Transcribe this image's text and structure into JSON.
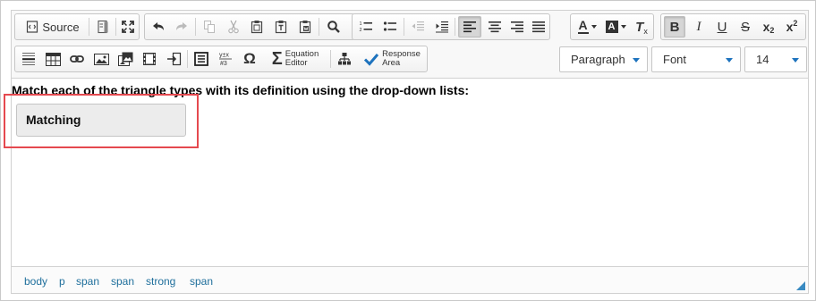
{
  "toolbar": {
    "row1": {
      "source_label": "Source",
      "format_text_color": "A",
      "format_bg_color": "A",
      "remove_format": "T",
      "bold": "B",
      "italic": "I",
      "underline": "U",
      "strike": "S",
      "subscript": "x",
      "subscript_mark": "2",
      "superscript": "x",
      "superscript_mark": "2"
    },
    "row2": {
      "equation_editor_line1": "Equation",
      "equation_editor_line2": "Editor",
      "response_area_line1": "Response",
      "response_area_line2": "Area",
      "omega": "Ω",
      "sigma": "Σ"
    },
    "dropdowns": {
      "paragraph": "Paragraph",
      "font": "Font",
      "size": "14"
    }
  },
  "content": {
    "prompt": "Match each of the triangle types with its definition using the drop-down lists:",
    "response_area_label": "Matching"
  },
  "status": {
    "path": [
      "body",
      "p",
      "span",
      "span",
      "strong",
      "span"
    ]
  },
  "colors": {
    "highlight": "#e5494f",
    "link_blue": "#1f6f9c",
    "accent": "#1e73be"
  }
}
